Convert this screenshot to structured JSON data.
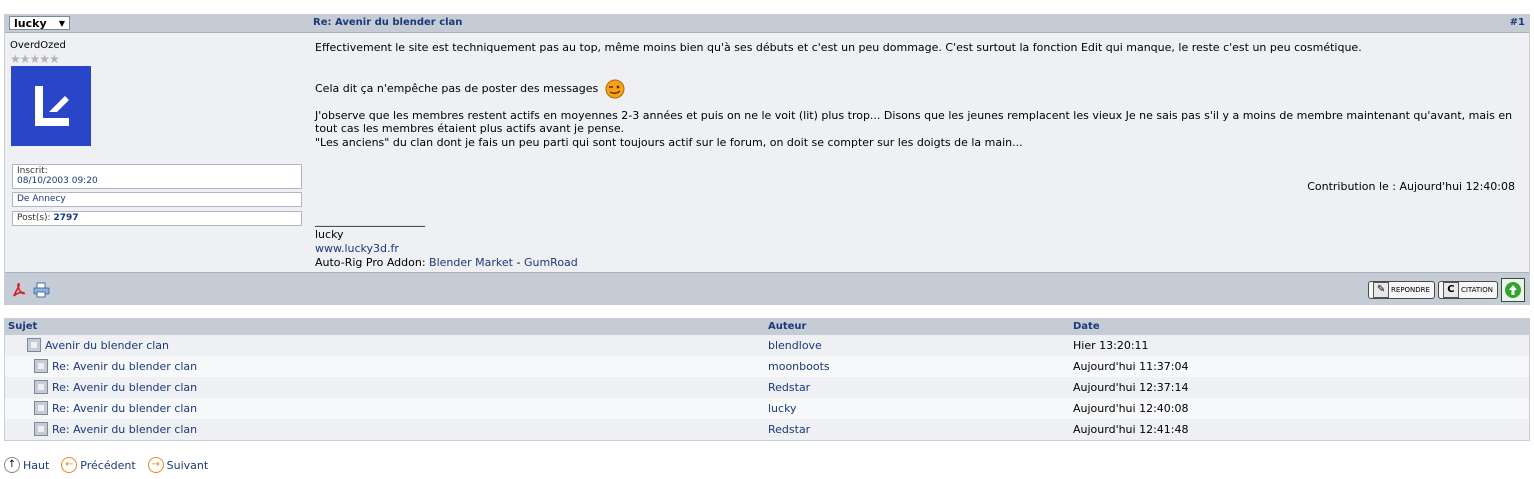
{
  "post": {
    "author_select": "lucky",
    "title": "Re: Avenir du blender clan",
    "number": "#1",
    "user_rank": "OverdOzed",
    "info": {
      "joined_label": "Inscrit:",
      "joined_date": "08/10/2003 09:20",
      "location": "De Annecy",
      "posts_label": "Post(s):",
      "posts_count": "2797"
    },
    "body": {
      "p1": "Effectivement le site est techniquement pas au top, même moins bien qu'à ses débuts et c'est un peu dommage. C'est surtout la fonction Edit qui manque, le reste c'est un peu cosmétique.",
      "p2": "Cela dit ça n'empêche pas de poster des messages",
      "p3": "J'observe que les membres restent actifs en moyennes 2-3 années et puis on ne le voit (lit) plus trop... Disons que les jeunes remplacent les vieux Je ne sais pas s'il y a moins de membre maintenant qu'avant, mais en tout cas les membres étaient plus actifs avant je pense.",
      "p4": "\"Les anciens\" du clan dont je fais un peu parti qui sont toujours actif sur le forum, on doit se compter sur les doigts de la main..."
    },
    "contribution": "Contribution le : Aujourd'hui 12:40:08",
    "signature": {
      "rule": "____________________",
      "name": "lucky",
      "url": "www.lucky3d.fr",
      "addon_prefix": "Auto-Rig Pro Addon: ",
      "link1": "Blender Market",
      "sep": " - ",
      "link2": "GumRoad"
    },
    "buttons": {
      "reply": "REPONDRE",
      "quote": "CITATION"
    }
  },
  "thread": {
    "headers": {
      "subject": "Sujet",
      "author": "Auteur",
      "date": "Date"
    },
    "rows": [
      {
        "subject": "Avenir du blender clan",
        "author": "blendlove",
        "date": "Hier 13:20:11"
      },
      {
        "subject": "Re: Avenir du blender clan",
        "author": "moonboots",
        "date": "Aujourd'hui 11:37:04"
      },
      {
        "subject": "Re: Avenir du blender clan",
        "author": "Redstar",
        "date": "Aujourd'hui 12:37:14"
      },
      {
        "subject": "Re: Avenir du blender clan",
        "author": "lucky",
        "date": "Aujourd'hui 12:40:08"
      },
      {
        "subject": "Re: Avenir du blender clan",
        "author": "Redstar",
        "date": "Aujourd'hui 12:41:48"
      }
    ]
  },
  "nav": {
    "top": "Haut",
    "prev": "Précédent",
    "next": "Suivant"
  },
  "colors": {
    "accent": "#1a3a7a",
    "header_bg": "#c6ccd6",
    "panel_bg": "#eef0f3",
    "avatar_bg": "#2a46c8"
  }
}
